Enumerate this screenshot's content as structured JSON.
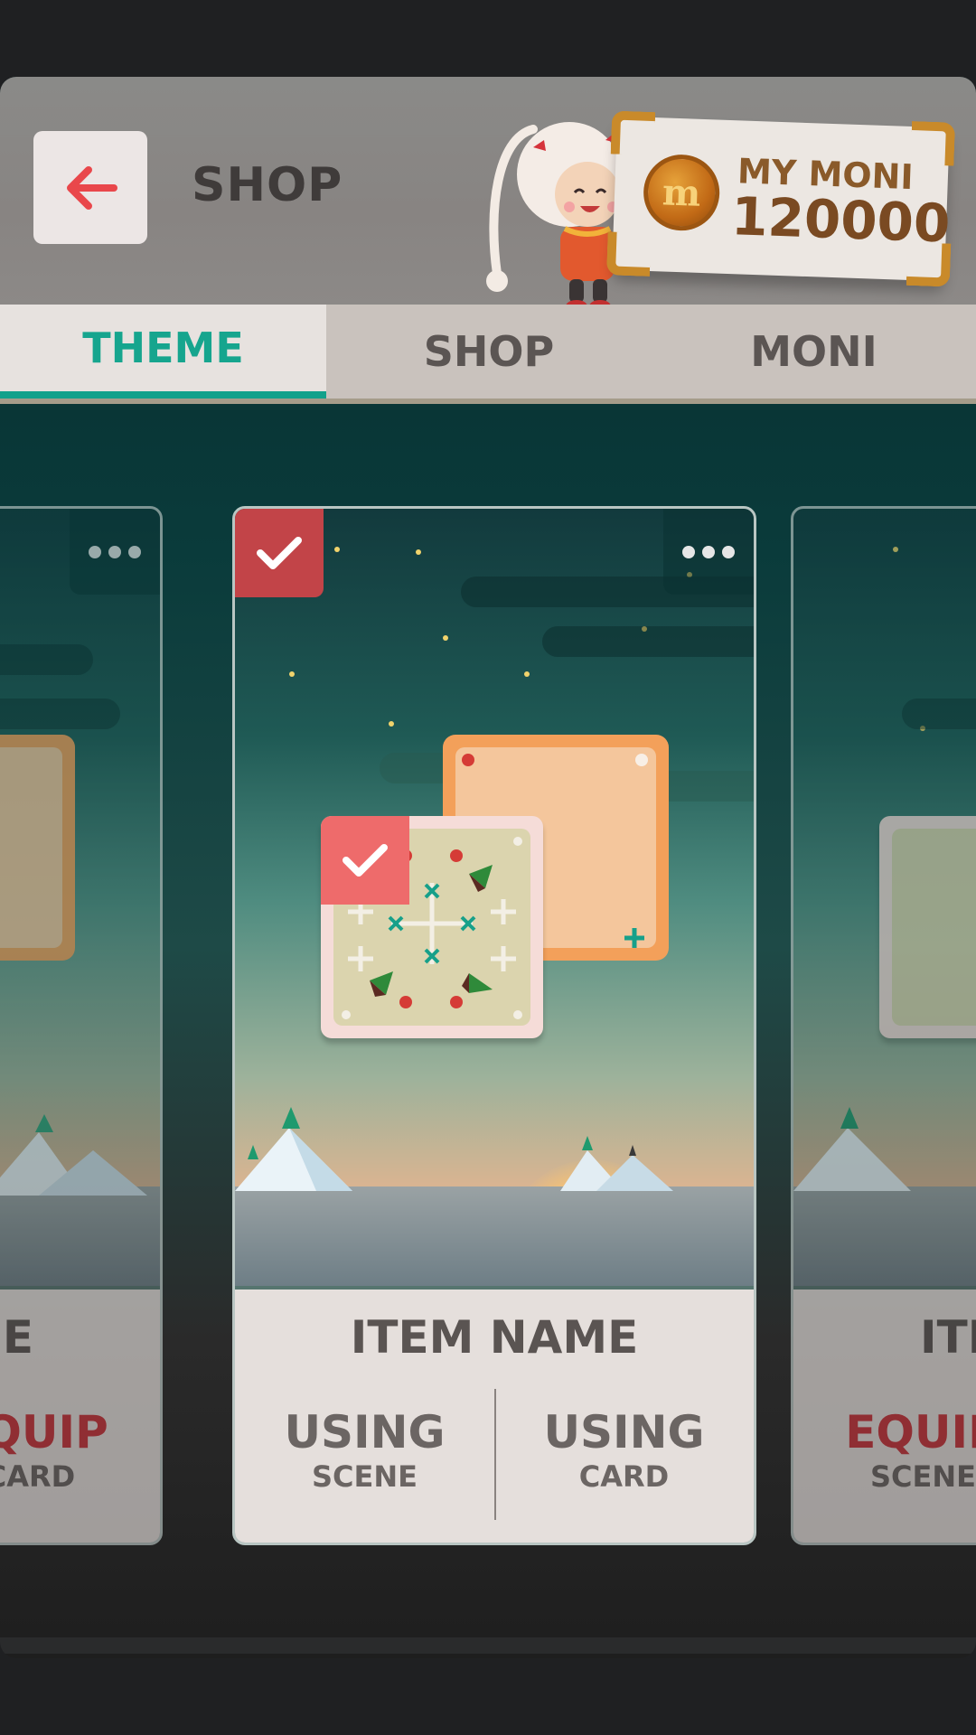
{
  "header": {
    "title": "SHOP",
    "back_icon": "arrow-left-icon",
    "moni": {
      "label": "MY MONI",
      "value": "120000",
      "coin_icon": "moni-coin-icon"
    }
  },
  "tabs": [
    {
      "label": "THEME",
      "active": true
    },
    {
      "label": "SHOP",
      "active": false
    },
    {
      "label": "MONI",
      "active": false
    }
  ],
  "cards": {
    "left": {
      "name": "ME",
      "col1": {
        "big": "EQUIP",
        "small": "CARD"
      }
    },
    "main": {
      "name": "ITEM NAME",
      "selected": true,
      "col1": {
        "big": "USING",
        "small": "SCENE"
      },
      "col2": {
        "big": "USING",
        "small": "CARD"
      }
    },
    "right": {
      "name": "ITE",
      "col1": {
        "big": "EQUIP",
        "small": "SCENE"
      }
    }
  },
  "colors": {
    "accent": "#12a18b",
    "equip": "#c8333a",
    "selected_badge": "#c24448"
  }
}
